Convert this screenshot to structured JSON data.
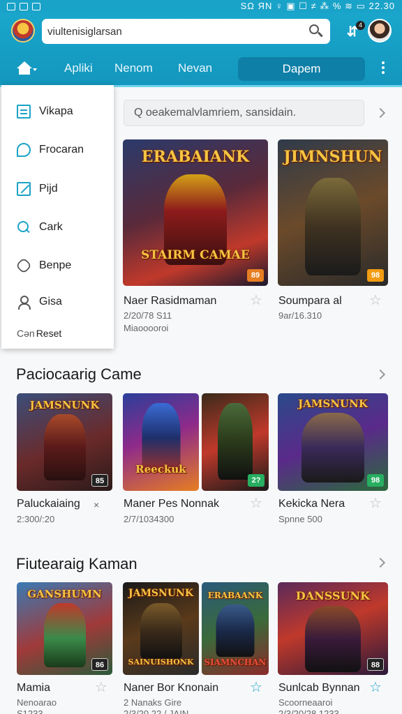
{
  "status_bar": {
    "right_text": "SΩ ЯΝ ♀ ▣ ☐ ≠ ⁂ % ≋ ▭ 22.30"
  },
  "search": {
    "value": "viultenisiglarsan"
  },
  "notifications": {
    "badge": "4"
  },
  "tabs": [
    {
      "label": "Apliki"
    },
    {
      "label": "Nenom"
    },
    {
      "label": "Nevan"
    },
    {
      "label": "Dapem"
    }
  ],
  "menu": [
    {
      "label": "Vikapa",
      "icon": "document-icon"
    },
    {
      "label": "Frocaran",
      "icon": "chat-icon"
    },
    {
      "label": "Pijd",
      "icon": "edit-icon"
    },
    {
      "label": "Cark",
      "icon": "search-icon"
    },
    {
      "label": "Benpe",
      "icon": "gear-icon"
    },
    {
      "label": "Gisa",
      "icon": "user-icon"
    },
    {
      "label": "Reset",
      "icon": "reset-icon",
      "prefix": "Cən"
    }
  ],
  "content_search": {
    "placeholder": "Q oeakemalvlamriem, sansidain."
  },
  "row1": [
    {
      "art_title": "ERABAIANK",
      "art_subtitle": "STAIRM CAMAE",
      "badge": "89",
      "badge_color": "#e67e22",
      "name": "Naer Rasidmaman",
      "line1": "2/20/78 S11",
      "line2": "Miaooooroi"
    },
    {
      "art_title": "JIMNSHUN",
      "art_subtitle": "",
      "badge": "98",
      "badge_color": "#f39c12",
      "name": "Soumpara al",
      "line1": "9ar/16.310",
      "line2": ""
    }
  ],
  "section2": {
    "title": "Paciocaarig Came",
    "cards": [
      {
        "art_title": "JAMSNUNK",
        "badge": "85",
        "badge_color": "#222222",
        "name": "Paluckaiaing",
        "line1": "2:300/:20",
        "star_text": "×"
      },
      {
        "art_title": "Reeckuk",
        "badge": "",
        "badge_color": "#222222",
        "name": "Maner Pes Nonnak",
        "line1": "2/7/1034300",
        "star_text": ""
      },
      {
        "art_title": "",
        "badge": "2?",
        "badge_color": "#27ae60",
        "name": "",
        "line1": "",
        "star_text": ""
      },
      {
        "art_title": "JAMSNUNK",
        "badge": "98",
        "badge_color": "#27ae60",
        "name": "Kekicka Nera",
        "line1": "Spnne 500",
        "star_text": ""
      }
    ]
  },
  "section3": {
    "title": "Fiutearaig Kaman",
    "cards": [
      {
        "art_title": "GANSHUMN",
        "badge": "86",
        "badge_color": "#222222",
        "name": "Mamia",
        "line1": "Nenoarao",
        "line2": "S1233"
      },
      {
        "art_title": "JAMSNUNK",
        "art_subtitle": "SAINUISHONK",
        "badge": "",
        "badge_color": "#222222",
        "name": "Naner Bor Knonain",
        "line1": "2 Nanaks Gire",
        "line2": "2/3/20 22 / JAIN"
      },
      {
        "art_title": "ERABAANK",
        "art_subtitle": "SIAMNCHAN",
        "badge": "",
        "badge_color": "#222222",
        "name": "",
        "line1": "",
        "line2": ""
      },
      {
        "art_title": "DANSSUNK",
        "badge": "88",
        "badge_color": "#222222",
        "name": "Sunlcab Bynnan",
        "line1": "Scoorneaaroi",
        "line2": "2/3/20/28 1233"
      }
    ]
  }
}
